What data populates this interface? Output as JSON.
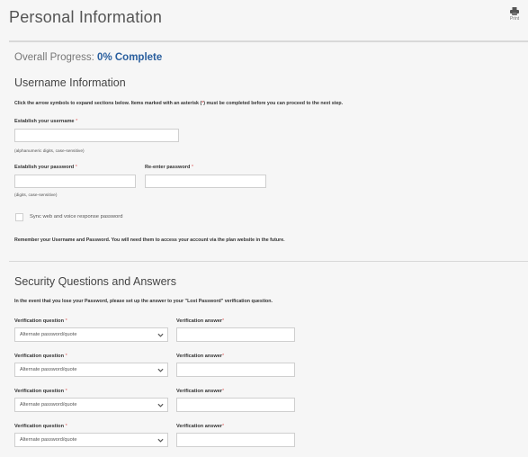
{
  "header": {
    "title": "Personal Information",
    "print_label": "Print"
  },
  "progress": {
    "label": "Overall Progress:",
    "value": "0% Complete",
    "percent": 0
  },
  "username_section": {
    "heading": "Username Information",
    "instruction_before": "Click the arrow symbols to expand sections below. Items marked with an asterisk (",
    "instruction_asterisk": "*",
    "instruction_after": ") must be completed before you can proceed to the next step.",
    "username_label": "Establish your username",
    "username_hint": "(alphanumeric digits, case-sensitive)",
    "username_value": "",
    "password_label": "Establish your password",
    "password_hint": "(digits, case-sensitive)",
    "password_value": "",
    "reenter_label": "Re-enter password",
    "reenter_value": "",
    "sync_label": "Sync web and voice response password",
    "sync_checked": false,
    "reminder": "Remember your Username and Password. You will need them to access your account via the plan website in the future.",
    "asterisk": "*"
  },
  "security_section": {
    "heading": "Security Questions and Answers",
    "instruction": "In the event that you lose your Password, please set up the answer to your \"Lost Password\" verification question.",
    "question_label": "Verification question",
    "answer_label": "Verification answer",
    "asterisk": "*",
    "rows": [
      {
        "question": "Alternate password/quote",
        "answer": ""
      },
      {
        "question": "Alternate password/quote",
        "answer": ""
      },
      {
        "question": "Alternate password/quote",
        "answer": ""
      },
      {
        "question": "Alternate password/quote",
        "answer": ""
      }
    ]
  }
}
